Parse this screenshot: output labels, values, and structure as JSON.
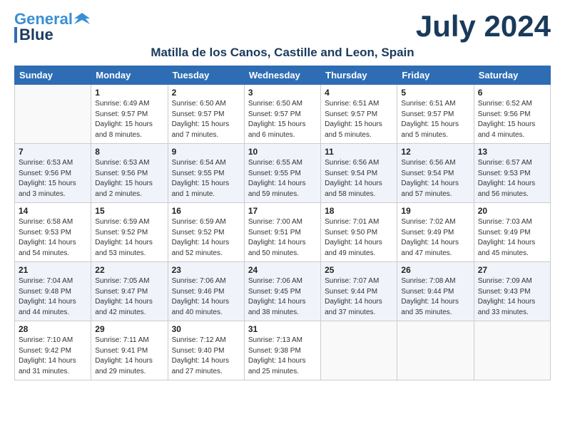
{
  "logo": {
    "line1": "General",
    "line2": "Blue"
  },
  "month": "July 2024",
  "location": "Matilla de los Canos, Castille and Leon, Spain",
  "weekdays": [
    "Sunday",
    "Monday",
    "Tuesday",
    "Wednesday",
    "Thursday",
    "Friday",
    "Saturday"
  ],
  "weeks": [
    [
      {
        "day": "",
        "info": ""
      },
      {
        "day": "1",
        "info": "Sunrise: 6:49 AM\nSunset: 9:57 PM\nDaylight: 15 hours\nand 8 minutes."
      },
      {
        "day": "2",
        "info": "Sunrise: 6:50 AM\nSunset: 9:57 PM\nDaylight: 15 hours\nand 7 minutes."
      },
      {
        "day": "3",
        "info": "Sunrise: 6:50 AM\nSunset: 9:57 PM\nDaylight: 15 hours\nand 6 minutes."
      },
      {
        "day": "4",
        "info": "Sunrise: 6:51 AM\nSunset: 9:57 PM\nDaylight: 15 hours\nand 5 minutes."
      },
      {
        "day": "5",
        "info": "Sunrise: 6:51 AM\nSunset: 9:57 PM\nDaylight: 15 hours\nand 5 minutes."
      },
      {
        "day": "6",
        "info": "Sunrise: 6:52 AM\nSunset: 9:56 PM\nDaylight: 15 hours\nand 4 minutes."
      }
    ],
    [
      {
        "day": "7",
        "info": "Sunrise: 6:53 AM\nSunset: 9:56 PM\nDaylight: 15 hours\nand 3 minutes."
      },
      {
        "day": "8",
        "info": "Sunrise: 6:53 AM\nSunset: 9:56 PM\nDaylight: 15 hours\nand 2 minutes."
      },
      {
        "day": "9",
        "info": "Sunrise: 6:54 AM\nSunset: 9:55 PM\nDaylight: 15 hours\nand 1 minute."
      },
      {
        "day": "10",
        "info": "Sunrise: 6:55 AM\nSunset: 9:55 PM\nDaylight: 14 hours\nand 59 minutes."
      },
      {
        "day": "11",
        "info": "Sunrise: 6:56 AM\nSunset: 9:54 PM\nDaylight: 14 hours\nand 58 minutes."
      },
      {
        "day": "12",
        "info": "Sunrise: 6:56 AM\nSunset: 9:54 PM\nDaylight: 14 hours\nand 57 minutes."
      },
      {
        "day": "13",
        "info": "Sunrise: 6:57 AM\nSunset: 9:53 PM\nDaylight: 14 hours\nand 56 minutes."
      }
    ],
    [
      {
        "day": "14",
        "info": "Sunrise: 6:58 AM\nSunset: 9:53 PM\nDaylight: 14 hours\nand 54 minutes."
      },
      {
        "day": "15",
        "info": "Sunrise: 6:59 AM\nSunset: 9:52 PM\nDaylight: 14 hours\nand 53 minutes."
      },
      {
        "day": "16",
        "info": "Sunrise: 6:59 AM\nSunset: 9:52 PM\nDaylight: 14 hours\nand 52 minutes."
      },
      {
        "day": "17",
        "info": "Sunrise: 7:00 AM\nSunset: 9:51 PM\nDaylight: 14 hours\nand 50 minutes."
      },
      {
        "day": "18",
        "info": "Sunrise: 7:01 AM\nSunset: 9:50 PM\nDaylight: 14 hours\nand 49 minutes."
      },
      {
        "day": "19",
        "info": "Sunrise: 7:02 AM\nSunset: 9:49 PM\nDaylight: 14 hours\nand 47 minutes."
      },
      {
        "day": "20",
        "info": "Sunrise: 7:03 AM\nSunset: 9:49 PM\nDaylight: 14 hours\nand 45 minutes."
      }
    ],
    [
      {
        "day": "21",
        "info": "Sunrise: 7:04 AM\nSunset: 9:48 PM\nDaylight: 14 hours\nand 44 minutes."
      },
      {
        "day": "22",
        "info": "Sunrise: 7:05 AM\nSunset: 9:47 PM\nDaylight: 14 hours\nand 42 minutes."
      },
      {
        "day": "23",
        "info": "Sunrise: 7:06 AM\nSunset: 9:46 PM\nDaylight: 14 hours\nand 40 minutes."
      },
      {
        "day": "24",
        "info": "Sunrise: 7:06 AM\nSunset: 9:45 PM\nDaylight: 14 hours\nand 38 minutes."
      },
      {
        "day": "25",
        "info": "Sunrise: 7:07 AM\nSunset: 9:44 PM\nDaylight: 14 hours\nand 37 minutes."
      },
      {
        "day": "26",
        "info": "Sunrise: 7:08 AM\nSunset: 9:44 PM\nDaylight: 14 hours\nand 35 minutes."
      },
      {
        "day": "27",
        "info": "Sunrise: 7:09 AM\nSunset: 9:43 PM\nDaylight: 14 hours\nand 33 minutes."
      }
    ],
    [
      {
        "day": "28",
        "info": "Sunrise: 7:10 AM\nSunset: 9:42 PM\nDaylight: 14 hours\nand 31 minutes."
      },
      {
        "day": "29",
        "info": "Sunrise: 7:11 AM\nSunset: 9:41 PM\nDaylight: 14 hours\nand 29 minutes."
      },
      {
        "day": "30",
        "info": "Sunrise: 7:12 AM\nSunset: 9:40 PM\nDaylight: 14 hours\nand 27 minutes."
      },
      {
        "day": "31",
        "info": "Sunrise: 7:13 AM\nSunset: 9:38 PM\nDaylight: 14 hours\nand 25 minutes."
      },
      {
        "day": "",
        "info": ""
      },
      {
        "day": "",
        "info": ""
      },
      {
        "day": "",
        "info": ""
      }
    ]
  ]
}
